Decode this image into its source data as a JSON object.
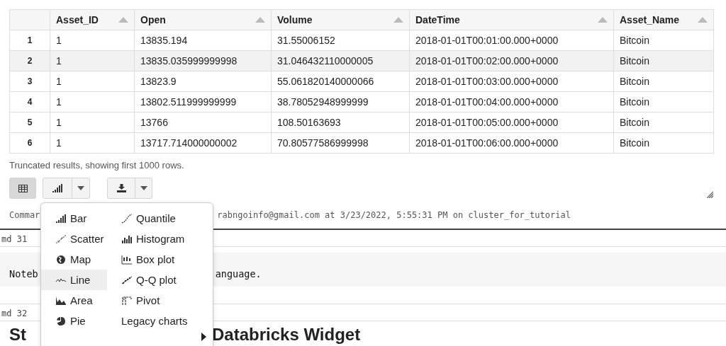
{
  "table": {
    "columns": [
      {
        "label": "Asset_ID",
        "sort_arrow": true
      },
      {
        "label": "Open",
        "sort_arrow": true
      },
      {
        "label": "Volume",
        "sort_arrow": true
      },
      {
        "label": "DateTime",
        "sort_arrow": true
      },
      {
        "label": "Asset_Name",
        "sort_arrow": true
      }
    ],
    "rows": [
      {
        "index": "1",
        "hovered": false,
        "cells": [
          "1",
          "13835.194",
          "31.55006152",
          "2018-01-01T00:01:00.000+0000",
          "Bitcoin"
        ]
      },
      {
        "index": "2",
        "hovered": true,
        "cells": [
          "1",
          "13835.035999999998",
          "31.046432110000005",
          "2018-01-01T00:02:00.000+0000",
          "Bitcoin"
        ]
      },
      {
        "index": "3",
        "hovered": false,
        "cells": [
          "1",
          "13823.9",
          "55.061820140000066",
          "2018-01-01T00:03:00.000+0000",
          "Bitcoin"
        ]
      },
      {
        "index": "4",
        "hovered": false,
        "cells": [
          "1",
          "13802.511999999999",
          "38.78052948999999",
          "2018-01-01T00:04:00.000+0000",
          "Bitcoin"
        ]
      },
      {
        "index": "5",
        "hovered": false,
        "cells": [
          "1",
          "13766",
          "108.50163693",
          "2018-01-01T00:05:00.000+0000",
          "Bitcoin"
        ]
      },
      {
        "index": "6",
        "hovered": false,
        "cells": [
          "1",
          "13717.714000000002",
          "70.80577586999998",
          "2018-01-01T00:06:00.000+0000",
          "Bitcoin"
        ]
      }
    ]
  },
  "truncation_note": "Truncated results, showing first 1000 rows.",
  "view_buttons": [
    {
      "kind": "table",
      "selected": true,
      "dropdown": false
    },
    {
      "kind": "chart",
      "selected": false,
      "dropdown": true
    }
  ],
  "download_button": {
    "dropdown": true
  },
  "command_line": {
    "left": "Commar",
    "right": "rabngoinfo@gmail.com at 3/23/2022, 5:55:31 PM on cluster_for_tutorial"
  },
  "cmd_31": "md 31",
  "notebook_line": {
    "left": "Noteb",
    "right": "anguage."
  },
  "cmd_32": "md 32",
  "heading": {
    "left": "St",
    "right": "Databricks Widget"
  },
  "chart_menu": {
    "items": [
      {
        "kind": "bar",
        "label": "Bar",
        "selected": false
      },
      {
        "kind": "scatter",
        "label": "Scatter",
        "selected": false
      },
      {
        "kind": "map",
        "label": "Map",
        "selected": false
      },
      {
        "kind": "line",
        "label": "Line",
        "selected": true
      },
      {
        "kind": "area",
        "label": "Area",
        "selected": false
      },
      {
        "kind": "pie",
        "label": "Pie",
        "selected": false
      },
      {
        "kind": "quantile",
        "label": "Quantile",
        "selected": false
      },
      {
        "kind": "histogram",
        "label": "Histogram",
        "selected": false
      },
      {
        "kind": "boxplot",
        "label": "Box plot",
        "selected": false
      },
      {
        "kind": "qq",
        "label": "Q-Q plot",
        "selected": false
      },
      {
        "kind": "pivot",
        "label": "Pivot",
        "selected": false
      },
      {
        "kind": "legacy",
        "label": "Legacy charts",
        "selected": false,
        "submenu": true
      }
    ]
  }
}
